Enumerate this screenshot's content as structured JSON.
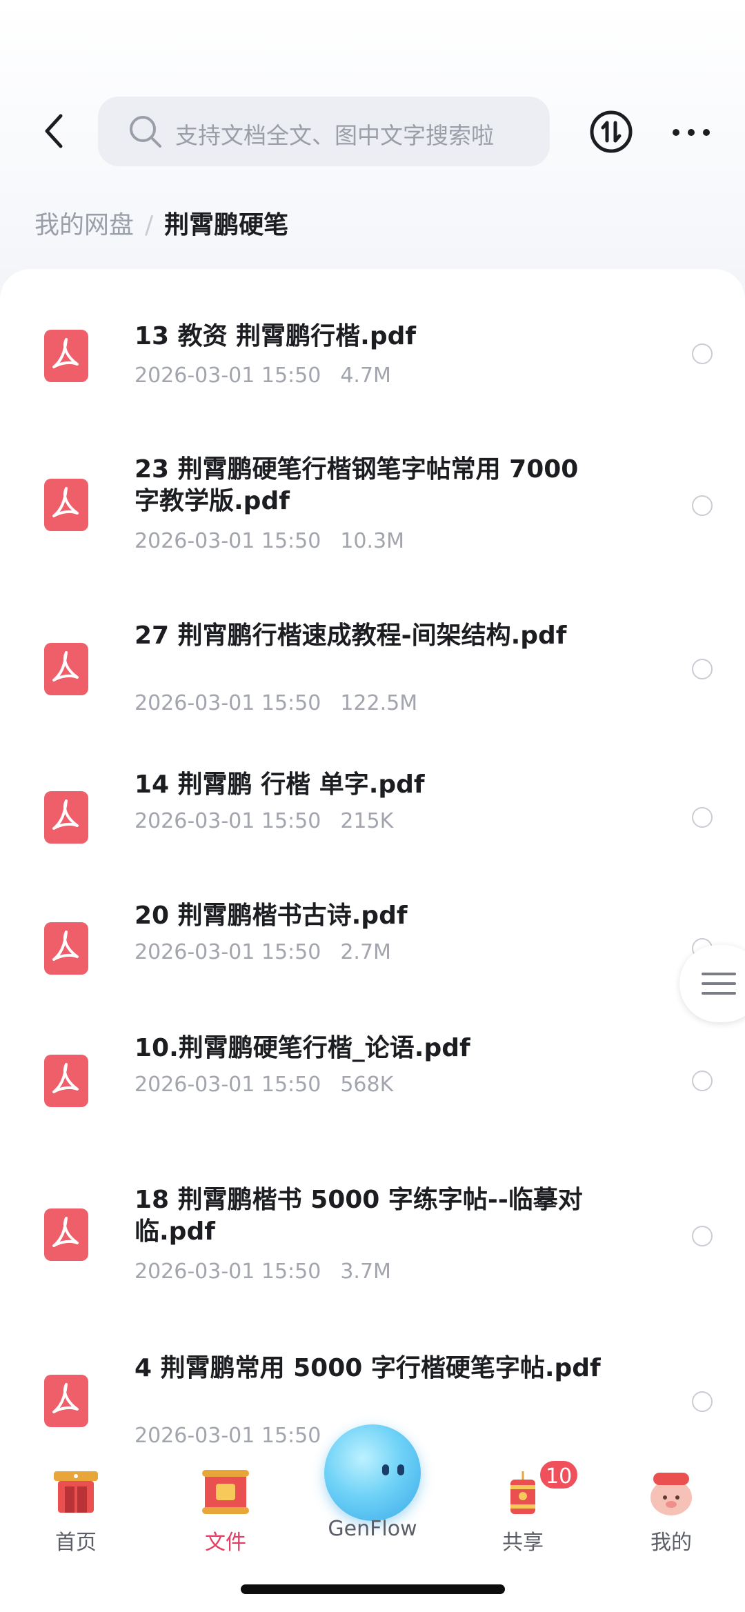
{
  "header": {
    "search_placeholder": "支持文档全文、图中文字搜索啦",
    "icons": {
      "back": "chevron-left-icon",
      "search": "search-icon",
      "sort": "sort-icon",
      "more": "more-dots-icon"
    }
  },
  "breadcrumb": {
    "root": "我的网盘",
    "separator": "/",
    "current": "荆霄鹏硬笔"
  },
  "files": [
    {
      "name": "13 教资  荆霄鹏行楷.pdf",
      "date": "2026-03-01 15:50",
      "size": "4.7M"
    },
    {
      "name": "23 荆霄鹏硬笔行楷钢笔字帖常用 7000 字教学版.pdf",
      "date": "2026-03-01 15:50",
      "size": "10.3M"
    },
    {
      "name": "27 荆宵鹏行楷速成教程-间架结构.pdf",
      "date": "2026-03-01 15:50",
      "size": "122.5M"
    },
    {
      "name": "14 荆霄鹏 行楷 单字.pdf",
      "date": "2026-03-01 15:50",
      "size": "215K"
    },
    {
      "name": "20 荆霄鹏楷书古诗.pdf",
      "date": "2026-03-01 15:50",
      "size": "2.7M"
    },
    {
      "name": "10.荆霄鹏硬笔行楷_论语.pdf",
      "date": "2026-03-01 15:50",
      "size": "568K"
    },
    {
      "name": "18 荆霄鹏楷书 5000 字练字帖--临摹对临.pdf",
      "date": "2026-03-01 15:50",
      "size": "3.7M"
    },
    {
      "name": "4 荆霄鹏常用 5000 字行楷硬笔字帖.pdf",
      "date": "2026-03-01 15:50",
      "size": ""
    }
  ],
  "tabbar": {
    "home": "首页",
    "files": "文件",
    "genflow": "GenFlow",
    "share": "共享",
    "share_badge": "10",
    "mine": "我的"
  },
  "colors": {
    "accent": "#e73b62",
    "pdf_red": "#ee5f6a",
    "badge": "#f0505c"
  }
}
